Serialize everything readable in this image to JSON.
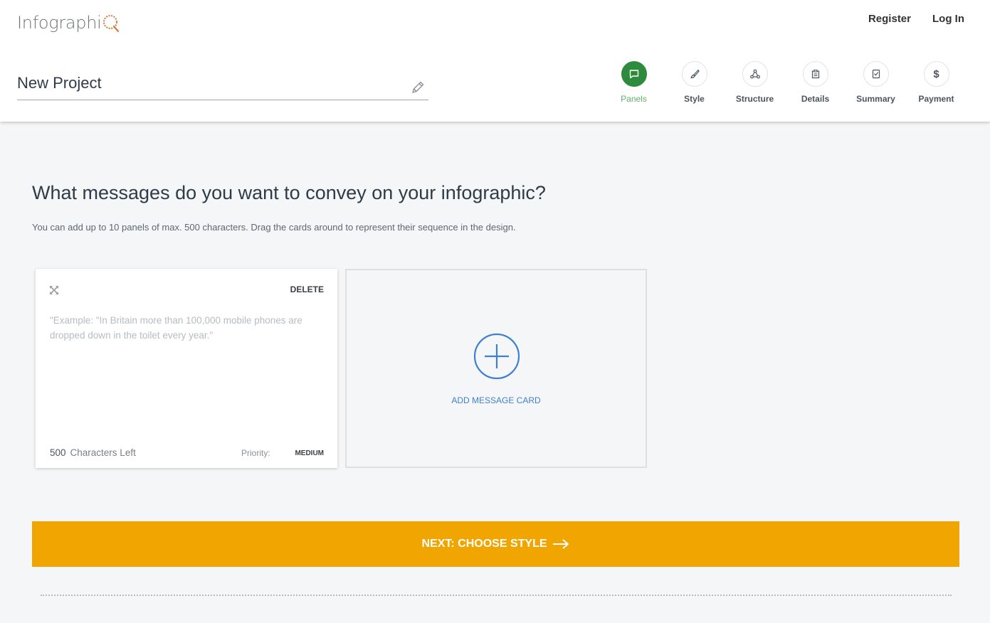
{
  "brand": {
    "logo_text": "Infographi",
    "logo_accent": "#d9773a"
  },
  "topnav": {
    "register": "Register",
    "login": "Log In"
  },
  "project": {
    "name": "New Project"
  },
  "steps": [
    {
      "label": "Panels",
      "icon": "chat-bubble-icon",
      "active": true
    },
    {
      "label": "Style",
      "icon": "brush-icon",
      "active": false
    },
    {
      "label": "Structure",
      "icon": "network-icon",
      "active": false
    },
    {
      "label": "Details",
      "icon": "clipboard-list-icon",
      "active": false
    },
    {
      "label": "Summary",
      "icon": "checklist-icon",
      "active": false
    },
    {
      "label": "Payment",
      "icon": "dollar-icon",
      "active": false
    }
  ],
  "main": {
    "title": "What messages do you want to convey on your infographic?",
    "subtitle": "You can add up to 10 panels of max. 500 characters. Drag the cards around to represent their sequence in the design."
  },
  "card": {
    "delete_label": "DELETE",
    "placeholder": "\"Example: \"In Britain more than 100,000 mobile phones are dropped down in the toilet every year.\"",
    "chars_count": "500",
    "chars_label": "Characters Left",
    "priority_label": "Priority:",
    "priority_value": "MEDIUM"
  },
  "add_card": {
    "label": "ADD MESSAGE CARD"
  },
  "next_button": {
    "label": "NEXT: CHOOSE STYLE"
  },
  "colors": {
    "accent_green": "#2e8a3c",
    "accent_orange": "#f0a500",
    "link_blue": "#3f7fd1"
  }
}
